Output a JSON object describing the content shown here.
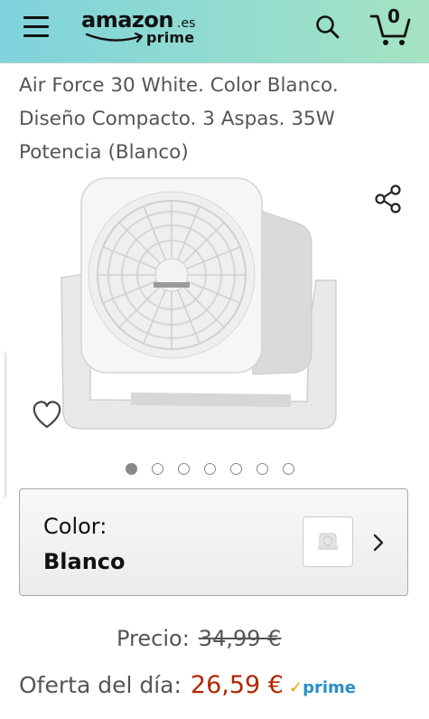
{
  "header": {
    "logo": {
      "word": "amazon",
      "tld": ".es",
      "prime": "prime"
    },
    "cart_count": "0",
    "colors": {
      "gradient_start": "#7fd3dc",
      "gradient_end": "#a6e3c3"
    }
  },
  "product": {
    "title_lines": [
      "Air Force 30 White. Color Blanco.",
      "Diseño Compacto. 3 Aspas. 35W",
      "Potencia (Blanco)"
    ],
    "image_dots_count": 7,
    "image_dots_active_index": 0,
    "color_label": "Color:",
    "color_value": "Blanco",
    "price_label": "Precio:",
    "price_old": "34,99 €",
    "deal_label": "Oferta del día:",
    "deal_price": "26,59 €",
    "prime_check": "✓",
    "prime_word": "prime",
    "price_color": "#b12704"
  },
  "icons": {
    "menu": "menu-icon",
    "search": "search-icon",
    "cart": "cart-icon",
    "share": "share-icon",
    "wishlist": "heart-icon",
    "chevron": "chevron-right-icon"
  }
}
